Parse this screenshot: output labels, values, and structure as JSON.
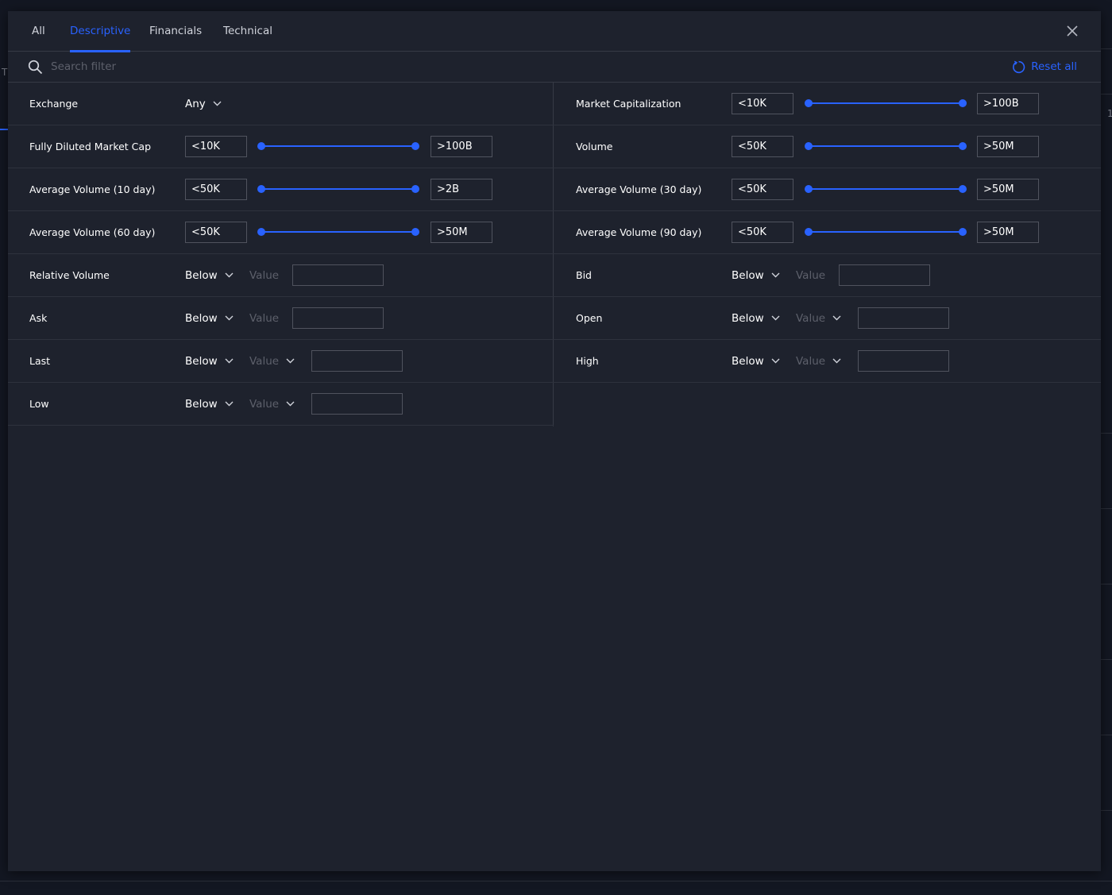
{
  "background": {
    "left_edge_chars": [
      "T"
    ],
    "right_edge_chars": [
      "1"
    ]
  },
  "tabs": [
    {
      "label": "All",
      "active": false
    },
    {
      "label": "Descriptive",
      "active": true
    },
    {
      "label": "Financials",
      "active": false
    },
    {
      "label": "Technical",
      "active": false
    }
  ],
  "search": {
    "placeholder": "Search filter",
    "value": ""
  },
  "reset_label": "Reset all",
  "colors": {
    "accent": "#2962ff",
    "dialog_bg": "#1e222d",
    "border": "#363a45"
  },
  "icons": {
    "search": "search-icon",
    "close": "close-icon",
    "reset": "refresh-icon",
    "chevron": "chevron-down-icon"
  },
  "filters": {
    "exchange": {
      "label": "Exchange",
      "value": "Any"
    },
    "market_cap": {
      "label": "Market Capitalization",
      "min": "<10K",
      "max": ">100B"
    },
    "fd_market_cap": {
      "label": "Fully Diluted Market Cap",
      "min": "<10K",
      "max": ">100B"
    },
    "volume": {
      "label": "Volume",
      "min": "<50K",
      "max": ">50M"
    },
    "avg_vol_10": {
      "label": "Average Volume (10 day)",
      "min": "<50K",
      "max": ">2B"
    },
    "avg_vol_30": {
      "label": "Average Volume (30 day)",
      "min": "<50K",
      "max": ">50M"
    },
    "avg_vol_60": {
      "label": "Average Volume (60 day)",
      "min": "<50K",
      "max": ">50M"
    },
    "avg_vol_90": {
      "label": "Average Volume (90 day)",
      "min": "<50K",
      "max": ">50M"
    },
    "relative_volume": {
      "label": "Relative Volume",
      "condition": "Below",
      "value_label": "Value",
      "input": ""
    },
    "bid": {
      "label": "Bid",
      "condition": "Below",
      "value_label": "Value",
      "input": ""
    },
    "ask": {
      "label": "Ask",
      "condition": "Below",
      "value_label": "Value",
      "input": ""
    },
    "open": {
      "label": "Open",
      "condition": "Below",
      "value_label": "Value",
      "input": ""
    },
    "last": {
      "label": "Last",
      "condition": "Below",
      "value_label": "Value",
      "input": ""
    },
    "high": {
      "label": "High",
      "condition": "Below",
      "value_label": "Value",
      "input": ""
    },
    "low": {
      "label": "Low",
      "condition": "Below",
      "value_label": "Value",
      "input": ""
    }
  }
}
